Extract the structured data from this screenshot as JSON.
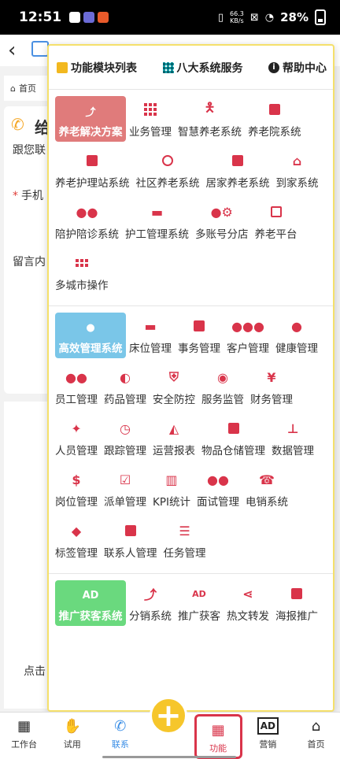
{
  "statusbar": {
    "time": "12:51",
    "speed": "66.3\nKB/s",
    "battery": "28%"
  },
  "background": {
    "breadcrumb": "首页",
    "title": "给",
    "line1": "跟您联",
    "line2": "手机",
    "line3": "留言内",
    "line4": "点击"
  },
  "tabs": [
    {
      "label": "功能模块列表",
      "icon": "list-icon",
      "color": "#f2b81f"
    },
    {
      "label": "八大系统服务",
      "icon": "grid-icon",
      "color": "#1aa0a8"
    },
    {
      "label": "帮助中心",
      "icon": "info-icon",
      "color": "#222222"
    }
  ],
  "sections": [
    {
      "highlight": {
        "label": "养老解决方案",
        "icon": "chart-icon",
        "color": "#e07b7b"
      },
      "items": [
        {
          "label": "业务管理",
          "icon": "grid-icon"
        },
        {
          "label": "智慧养老系统",
          "icon": "walking-cane-icon"
        },
        {
          "label": "养老院系统",
          "icon": "building-icon"
        },
        {
          "label": "养老护理站系统",
          "icon": "hospital-icon"
        },
        {
          "label": "社区养老系统",
          "icon": "lifebuoy-icon"
        },
        {
          "label": "居家养老系统",
          "icon": "building-icon"
        },
        {
          "label": "到家系统",
          "icon": "home-icon"
        },
        {
          "label": "陪护陪诊系统",
          "icon": "users-icon"
        },
        {
          "label": "护工管理系统",
          "icon": "bed-icon"
        },
        {
          "label": "多账号分店",
          "icon": "users-gear-icon"
        },
        {
          "label": "养老平台",
          "icon": "laptop-code-icon"
        },
        {
          "label": "多城市操作",
          "icon": "dots-grid-icon"
        }
      ]
    },
    {
      "highlight": {
        "label": "高效管理系统",
        "icon": "user-tie-icon",
        "color": "#7ac6e8"
      },
      "items": [
        {
          "label": "床位管理",
          "icon": "bed-icon"
        },
        {
          "label": "事务管理",
          "icon": "calendar-icon"
        },
        {
          "label": "客户管理",
          "icon": "users-icon"
        },
        {
          "label": "健康管理",
          "icon": "user-md-icon"
        },
        {
          "label": "员工管理",
          "icon": "users-icon"
        },
        {
          "label": "药品管理",
          "icon": "pills-icon"
        },
        {
          "label": "安全防控",
          "icon": "shield-icon"
        },
        {
          "label": "服务监管",
          "icon": "eye-icon"
        },
        {
          "label": "财务管理",
          "icon": "yen-icon"
        },
        {
          "label": "人员管理",
          "icon": "walking-icon"
        },
        {
          "label": "跟踪管理",
          "icon": "clock-icon"
        },
        {
          "label": "运营报表",
          "icon": "area-chart-icon"
        },
        {
          "label": "物品仓储管理",
          "icon": "store-icon"
        },
        {
          "label": "数据管理",
          "icon": "pin-icon"
        },
        {
          "label": "岗位管理",
          "icon": "hand-dollar-icon"
        },
        {
          "label": "派单管理",
          "icon": "calendar-check-icon"
        },
        {
          "label": "KPI统计",
          "icon": "bar-chart-icon"
        },
        {
          "label": "面试管理",
          "icon": "users-icon"
        },
        {
          "label": "电销系统",
          "icon": "fax-icon"
        },
        {
          "label": "标签管理",
          "icon": "tags-icon"
        },
        {
          "label": "联系人管理",
          "icon": "phone-square-icon"
        },
        {
          "label": "任务管理",
          "icon": "tasks-icon"
        }
      ]
    },
    {
      "highlight": {
        "label": "推广获客系统",
        "icon": "ad-icon",
        "color": "#6ad97e"
      },
      "items": [
        {
          "label": "分销系统",
          "icon": "line-chart-icon"
        },
        {
          "label": "推广获客",
          "icon": "ad-icon"
        },
        {
          "label": "热文转发",
          "icon": "share-icon"
        },
        {
          "label": "海报推广",
          "icon": "image-icon"
        }
      ]
    }
  ],
  "bottomnav": [
    {
      "label": "工作台",
      "icon": "solar-panel-icon"
    },
    {
      "label": "试用",
      "icon": "handshake-icon"
    },
    {
      "label": "联系",
      "icon": "phone-icon",
      "active": true
    },
    {
      "label": "",
      "icon": "plus-icon",
      "fab": true
    },
    {
      "label": "功能",
      "icon": "grid-icon",
      "highlighted": true
    },
    {
      "label": "营销",
      "icon": "ad-icon"
    },
    {
      "label": "首页",
      "icon": "home-icon"
    }
  ],
  "colors": {
    "accent_red": "#d9344a",
    "active_blue": "#3a8ee6",
    "fab_yellow": "#f6c62b",
    "panel_border": "#f5e06b"
  }
}
